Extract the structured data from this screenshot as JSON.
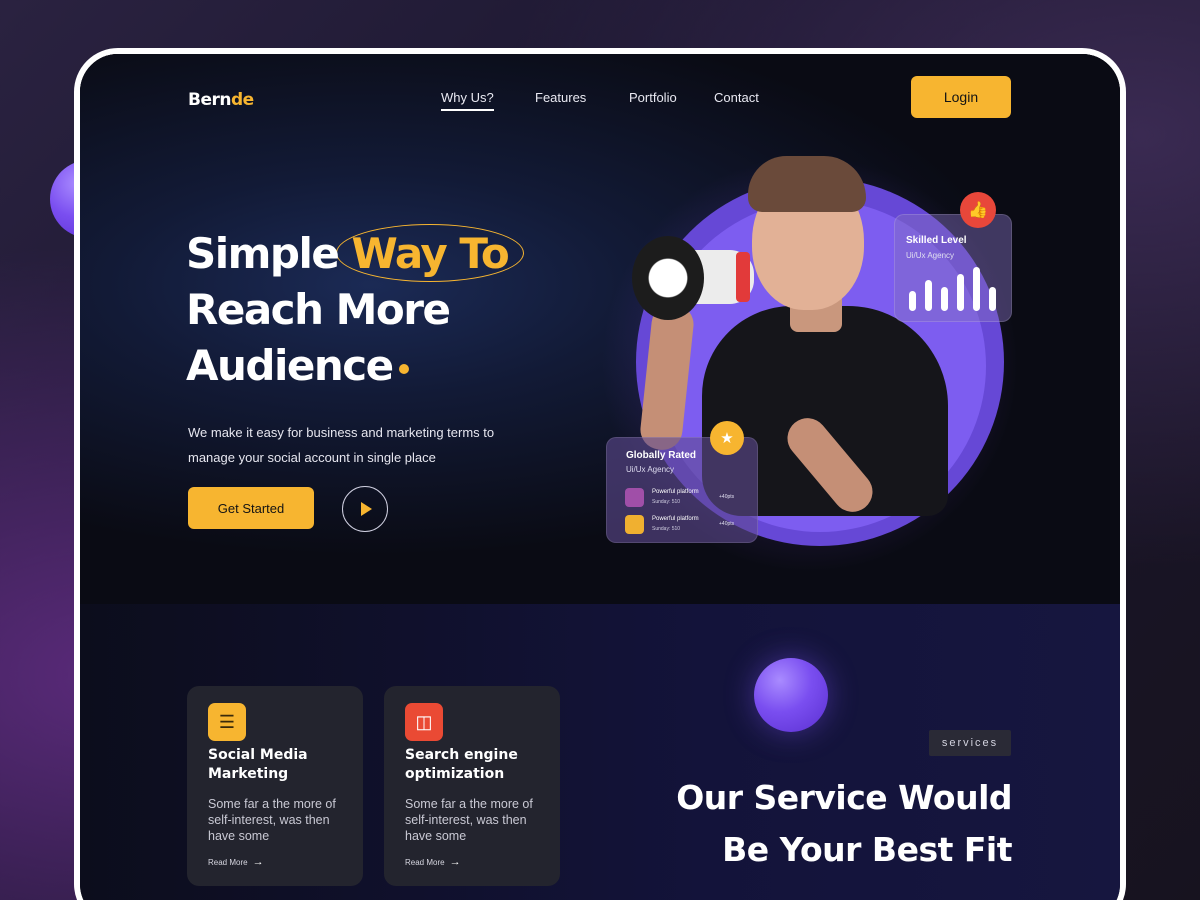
{
  "brand": {
    "logo_main": "Bern",
    "logo_accent": "de",
    "accent_color": "#f7b530"
  },
  "nav": {
    "items": [
      {
        "label": "Why Us?",
        "active": true
      },
      {
        "label": "Features"
      },
      {
        "label": "Portfolio"
      },
      {
        "label": "Contact"
      }
    ],
    "login_label": "Login"
  },
  "hero": {
    "headline_part1": "Simple",
    "headline_highlight": "Way To",
    "headline_line2": "Reach More",
    "headline_line3": "Audience",
    "subtext": "We make it easy for business and marketing terms to manage your social account in single place",
    "cta_label": "Get Started",
    "play_icon": "play-icon"
  },
  "skill_card": {
    "title": "Skilled Level",
    "subtitle": "Ui/Ux Agency",
    "badge_icon": "thumbs-up-icon",
    "bar_levels": [
      0.45,
      0.7,
      0.55,
      0.85,
      1.0,
      0.55
    ]
  },
  "rated_card": {
    "title": "Globally Rated",
    "subtitle": "Ui/Ux Agency",
    "badge_icon": "medal-icon",
    "rows": [
      {
        "title": "Powerful platform",
        "meta": "Sunday: 510",
        "points": "+40pts"
      },
      {
        "title": "Powerful platform",
        "meta": "Sunday: 510",
        "points": "+40pts"
      }
    ]
  },
  "services": {
    "tag": "services",
    "heading_line1": "Our Service Would",
    "heading_line2": "Be Your Best Fit",
    "cards": [
      {
        "icon": "social-media-icon",
        "title": "Social Media Marketing",
        "description": "Some far a the more of self-interest, was then have some",
        "link": "Read More"
      },
      {
        "icon": "seo-monitor-icon",
        "title": "Search engine optimization",
        "description": "Some far a the more of self-interest, was then have some",
        "link": "Read More"
      }
    ]
  }
}
